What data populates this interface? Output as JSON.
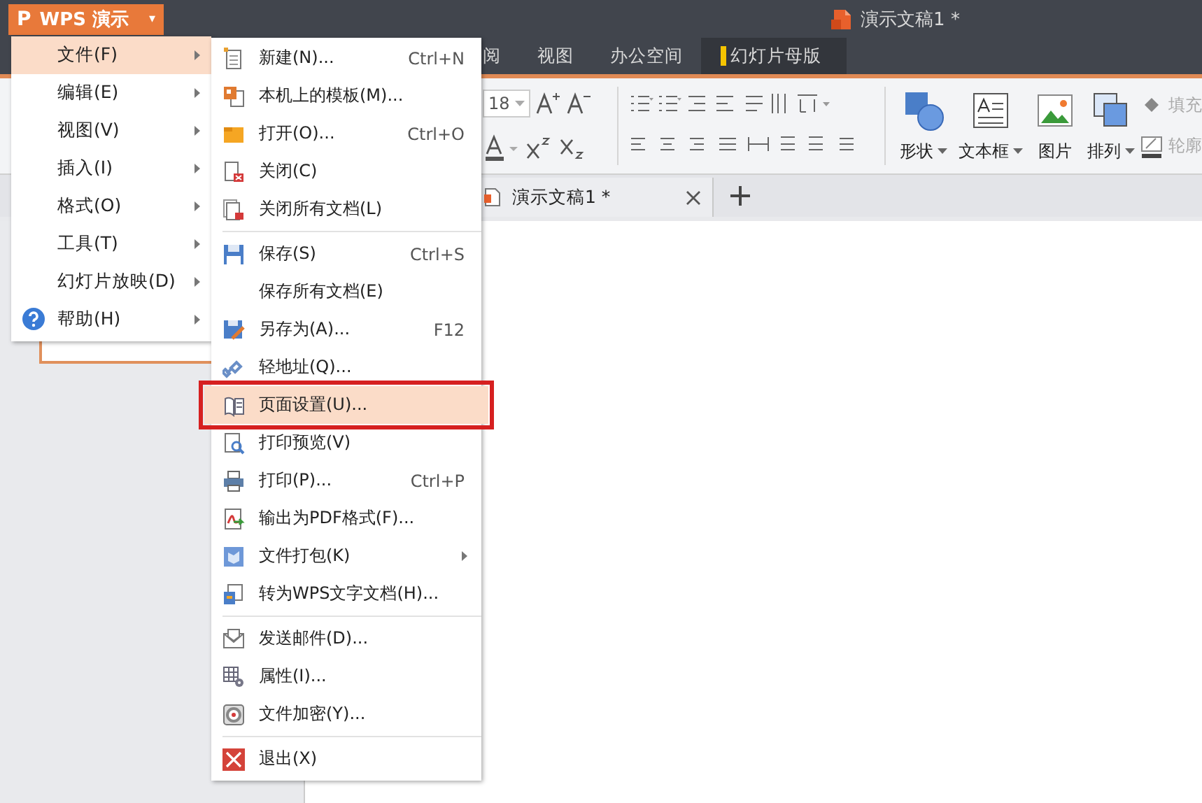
{
  "app_button": {
    "logo": "P",
    "label": "WPS 演示",
    "caret": "▾"
  },
  "window": {
    "title": "演示文稿1 *"
  },
  "ribbon_tabs": [
    {
      "label": "阅",
      "selected": false
    },
    {
      "label": "视图",
      "selected": false
    },
    {
      "label": "办公空间",
      "selected": false
    },
    {
      "label": "幻灯片母版",
      "selected": true
    }
  ],
  "ribbon": {
    "font_size": "18",
    "buttons": [
      {
        "label": "形状",
        "dropdown": true
      },
      {
        "label": "文本框",
        "dropdown": true
      },
      {
        "label": "图片",
        "dropdown": false
      },
      {
        "label": "排列",
        "dropdown": true
      }
    ],
    "side_buttons": [
      {
        "label": "填充",
        "disabled": true
      },
      {
        "label": "轮廓",
        "disabled": true
      }
    ]
  },
  "document_tabs": [
    {
      "label": "演示文稿1 *"
    }
  ],
  "main_menu": [
    {
      "label": "文件(F)",
      "submenu": true,
      "selected": true
    },
    {
      "label": "编辑(E)",
      "submenu": true,
      "selected": false
    },
    {
      "label": "视图(V)",
      "submenu": true,
      "selected": false
    },
    {
      "label": "插入(I)",
      "submenu": true,
      "selected": false
    },
    {
      "label": "格式(O)",
      "submenu": true,
      "selected": false
    },
    {
      "label": "工具(T)",
      "submenu": true,
      "selected": false
    },
    {
      "label": "幻灯片放映(D)",
      "submenu": true,
      "selected": false
    },
    {
      "label": "帮助(H)",
      "submenu": true,
      "selected": false
    }
  ],
  "file_menu": [
    [
      {
        "label": "新建(N)...",
        "shortcut": "Ctrl+N",
        "selected": false
      },
      {
        "label": "本机上的模板(M)...",
        "selected": false
      },
      {
        "label": "打开(O)...",
        "shortcut": "Ctrl+O",
        "selected": false
      },
      {
        "label": "关闭(C)",
        "selected": false
      },
      {
        "label": "关闭所有文档(L)",
        "selected": false
      }
    ],
    [
      {
        "label": "保存(S)",
        "shortcut": "Ctrl+S",
        "selected": false
      },
      {
        "label": "保存所有文档(E)",
        "selected": false
      },
      {
        "label": "另存为(A)...",
        "shortcut": "F12",
        "selected": false
      },
      {
        "label": "轻地址(Q)...",
        "selected": false
      },
      {
        "label": "页面设置(U)...",
        "selected": true,
        "outlined": true
      },
      {
        "label": "打印预览(V)",
        "selected": false
      },
      {
        "label": "打印(P)...",
        "shortcut": "Ctrl+P",
        "selected": false
      },
      {
        "label": "输出为PDF格式(F)...",
        "selected": false
      },
      {
        "label": "文件打包(K)",
        "submenu": true,
        "selected": false
      },
      {
        "label": "转为WPS文字文档(H)...",
        "selected": false
      }
    ],
    [
      {
        "label": "发送邮件(D)...",
        "selected": false
      },
      {
        "label": "属性(I)...",
        "selected": false
      },
      {
        "label": "文件加密(Y)...",
        "selected": false
      }
    ],
    [
      {
        "label": "退出(X)",
        "selected": false
      }
    ]
  ]
}
